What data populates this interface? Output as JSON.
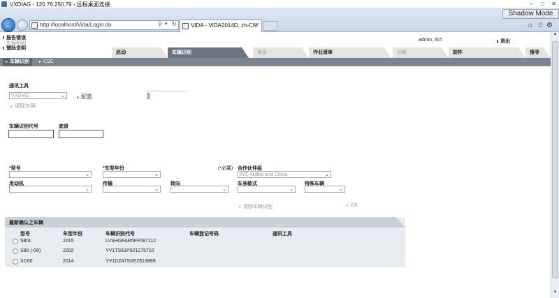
{
  "window": {
    "title": "VXDIAG - 120.76.250.79 - 远程桌面连接",
    "shadow_mode": "Shadow Mode"
  },
  "browser": {
    "url": "http://localhost/Vida/Login.do",
    "tab_title": "VIDA - VIDA2014D, zh-CN"
  },
  "menu": {
    "items": [
      {
        "label": "报告错误",
        "enabled": true
      },
      {
        "label": "车辆明细",
        "enabled": false
      },
      {
        "label": "辅助说明",
        "enabled": true
      }
    ]
  },
  "user": {
    "name": "admin, INT",
    "logout": "退出"
  },
  "tabs": [
    {
      "label": "启动",
      "state": "normal"
    },
    {
      "label": "车辆识别",
      "state": "active"
    },
    {
      "label": "信息",
      "state": "disabled"
    },
    {
      "label": "作业清单",
      "state": "normal"
    },
    {
      "label": "诊断",
      "state": "disabled"
    },
    {
      "label": "软件",
      "state": "normal"
    },
    {
      "label": "搜寻",
      "state": "normal"
    }
  ],
  "subtabs": [
    {
      "label": "车辆识别",
      "active": true
    },
    {
      "label": "CSC",
      "active": false
    }
  ],
  "comm_tool": {
    "label": "通讯工具",
    "value": "VXDIAG",
    "config_label": "配置",
    "read_vehicle_label": "读取车辆"
  },
  "vin_section": {
    "vin_label": "车辆识别代号",
    "chassis_label": "底盘"
  },
  "fields": {
    "model_label": "*型号",
    "year_label": "*车型年份",
    "required_note": "(*必要)",
    "partner_label": "合作伙伴组",
    "partner_value": "INT, Arabia and China",
    "engine_label": "发动机",
    "transmission_label": "传输",
    "steering_label": "转向",
    "body_label": "车身款式",
    "special_label": "特殊车辆"
  },
  "buttons": {
    "clear": "清除车辆识别",
    "ok": "OK"
  },
  "recent": {
    "title": "最新确认之车辆",
    "columns": [
      "型号",
      "车型年份",
      "车辆识别代号",
      "车辆登记号码",
      "通讯工具"
    ],
    "rows": [
      {
        "model": "S80L",
        "year": "2015",
        "vin": "LVSHGFAR5FF087112"
      },
      {
        "model": "S80 (-06)",
        "year": "2002",
        "vin": "YV1TS61P921275710"
      },
      {
        "model": "XC60",
        "year": "2014",
        "vin": "YV1DZ47SXE2513889"
      }
    ]
  }
}
